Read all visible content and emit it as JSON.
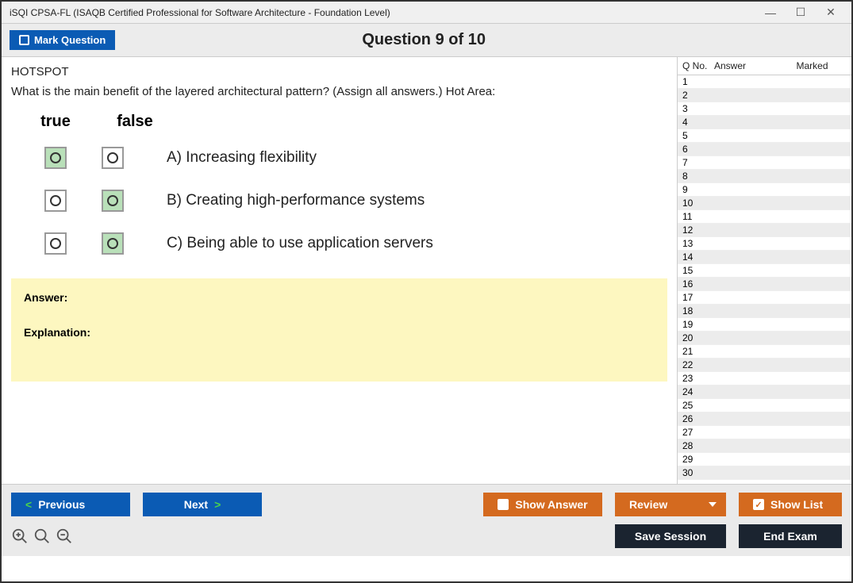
{
  "window": {
    "title": "iSQI CPSA-FL (ISAQB Certified Professional for Software Architecture - Foundation Level)"
  },
  "topbar": {
    "mark_label": "Mark Question",
    "counter_prefix": "Question",
    "counter_current": "9",
    "counter_of": "of",
    "counter_total": "10"
  },
  "question": {
    "section_label": "HOTSPOT",
    "prompt": "What is the main benefit of the layered architectural pattern? (Assign all answers.) Hot Area:",
    "headers": {
      "true": "true",
      "false": "false"
    },
    "options": [
      {
        "true_selected": true,
        "false_selected": false,
        "text": "A) Increasing flexibility"
      },
      {
        "true_selected": false,
        "false_selected": true,
        "text": "B) Creating high-performance systems"
      },
      {
        "true_selected": false,
        "false_selected": true,
        "text": "C) Being able to use application servers"
      }
    ]
  },
  "answer_box": {
    "answer_label": "Answer:",
    "explanation_label": "Explanation:"
  },
  "nav_table": {
    "headers": {
      "qno": "Q No.",
      "answer": "Answer",
      "marked": "Marked"
    },
    "rows": [
      1,
      2,
      3,
      4,
      5,
      6,
      7,
      8,
      9,
      10,
      11,
      12,
      13,
      14,
      15,
      16,
      17,
      18,
      19,
      20,
      21,
      22,
      23,
      24,
      25,
      26,
      27,
      28,
      29,
      30
    ]
  },
  "buttons": {
    "previous": "Previous",
    "next": "Next",
    "show_answer": "Show Answer",
    "review": "Review",
    "show_list": "Show List",
    "save_session": "Save Session",
    "end_exam": "End Exam"
  }
}
